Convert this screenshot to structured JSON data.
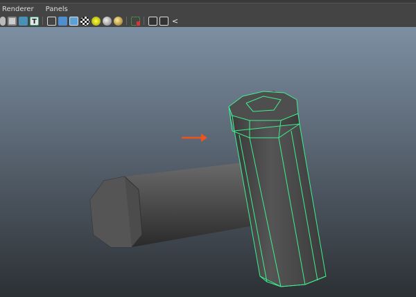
{
  "menu": {
    "items": [
      "Renderer",
      "Panels"
    ]
  },
  "toolbar": {
    "icons": [
      "isolate-icon",
      "xray-icon",
      "textured-icon",
      "texture-display-icon",
      "wireframe-icon",
      "smooth-shade-icon",
      "shaded-wireframe-icon",
      "checker-icon",
      "default-light-icon",
      "all-lights-icon",
      "flat-light-icon",
      "select-camera-icon",
      "isolate-select-icon",
      "bounding-box-icon",
      "backface-icon"
    ]
  },
  "colors": {
    "selection_wire": "#3df28f",
    "arrow": "#f0541e",
    "viewport_top": "#7d8fa3",
    "viewport_bottom": "#2c3034"
  }
}
